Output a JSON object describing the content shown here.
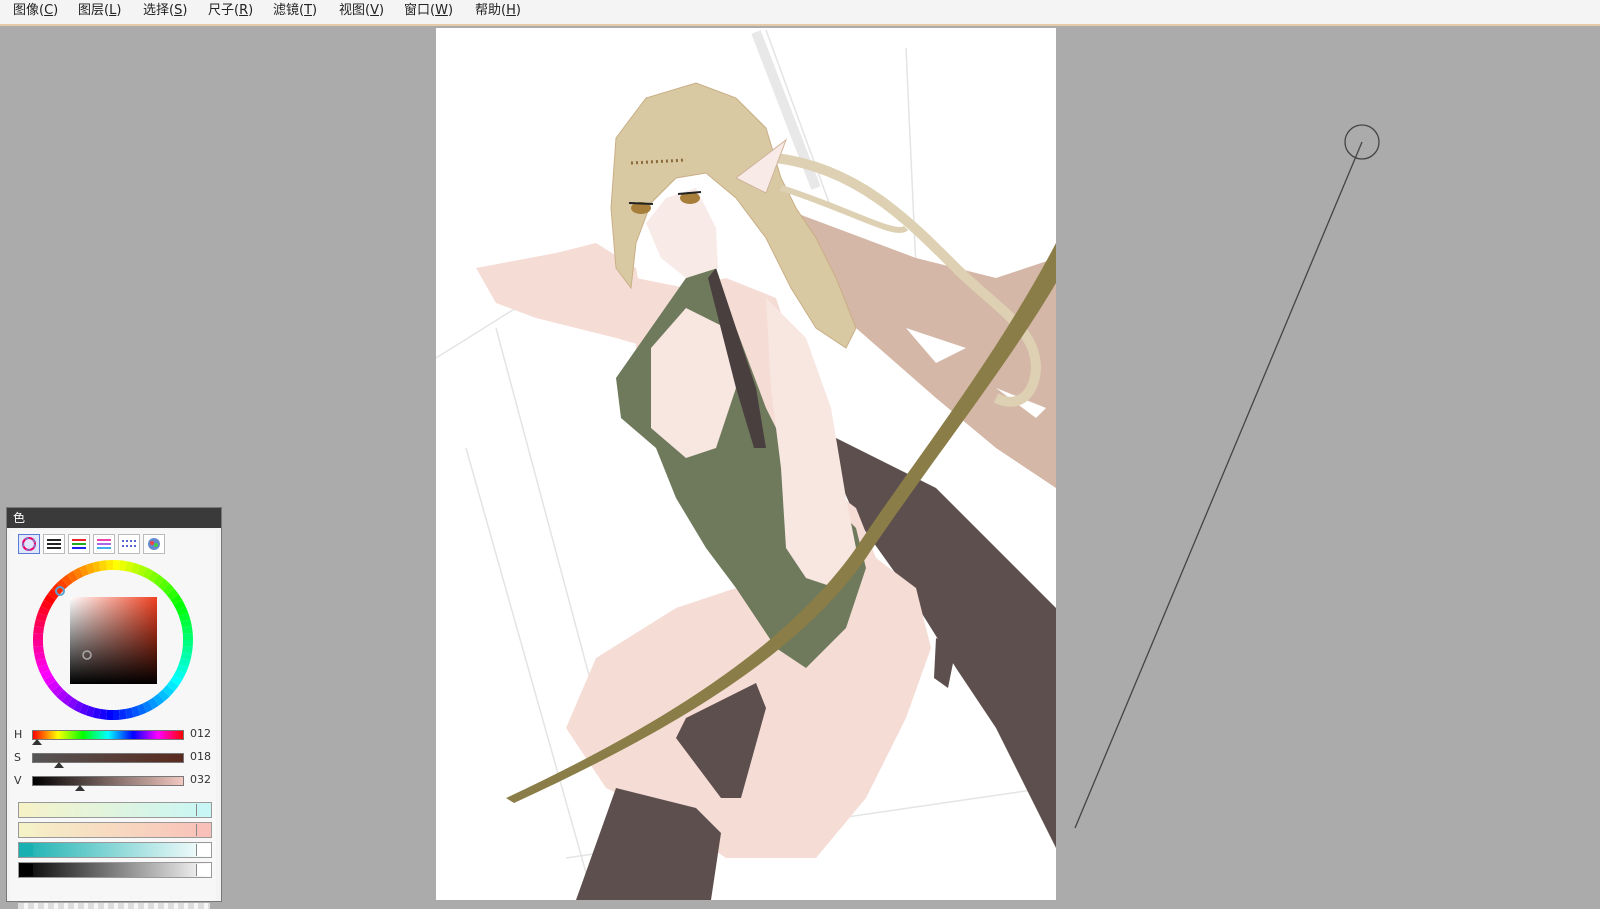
{
  "menu": {
    "items": [
      {
        "label": "图像(",
        "key": "C",
        "suffix": ")"
      },
      {
        "label": "图层(",
        "key": "L",
        "suffix": ")"
      },
      {
        "label": "选择(",
        "key": "S",
        "suffix": ")"
      },
      {
        "label": "尺子(",
        "key": "R",
        "suffix": ")"
      },
      {
        "label": "滤镜(",
        "key": "T",
        "suffix": ")"
      },
      {
        "label": "视图(",
        "key": "V",
        "suffix": ")"
      },
      {
        "label": "窗口(",
        "key": "W",
        "suffix": ")"
      },
      {
        "label": "帮助(",
        "key": "H",
        "suffix": ")"
      }
    ]
  },
  "color_panel": {
    "title": "色",
    "tabs": [
      "color-wheel-tab-icon",
      "gray-lines-tab-icon",
      "rgb-sliders-tab-icon",
      "hsv-sliders-tab-icon",
      "swatches-tab-icon",
      "palette-tab-icon"
    ],
    "active_tab_index": 0,
    "sliders": [
      {
        "label": "H",
        "value": "012",
        "fraction": 0.033
      },
      {
        "label": "S",
        "value": "018",
        "fraction": 0.18
      },
      {
        "label": "V",
        "value": "032",
        "fraction": 0.32
      }
    ],
    "current_color": "#5c4a48",
    "bars": [
      {
        "from": "#f6f2c8",
        "to": "#c8f6f6"
      },
      {
        "from": "#f6f2c8",
        "to": "#f8c0b8"
      },
      {
        "from": "#18b0b0",
        "to": "#ffffff"
      },
      {
        "from": "#000000",
        "to": "#ffffff"
      }
    ]
  },
  "colors": {
    "hair": "#d9c9a2",
    "skin": "#f5ddd6",
    "dress": "#6f7a5c",
    "bow": "#8b7d47",
    "cape": "#5e4f4f",
    "hair_back": "#d4b7a6"
  }
}
